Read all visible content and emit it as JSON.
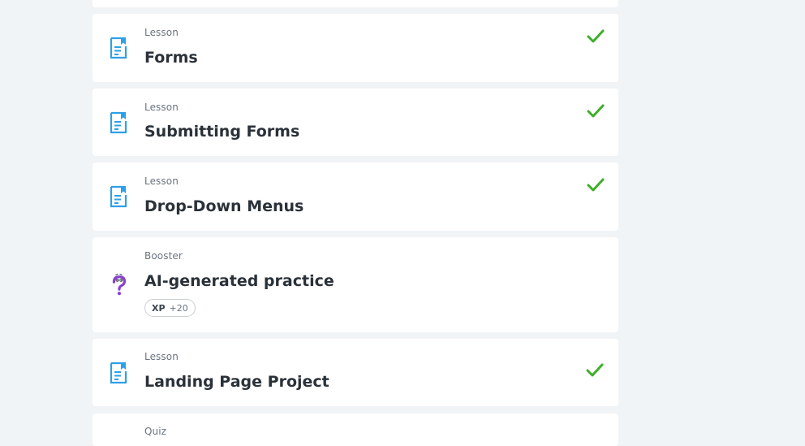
{
  "items": [
    {
      "type": "Lesson",
      "title": "Forms",
      "icon": "lesson-icon",
      "completed": true
    },
    {
      "type": "Lesson",
      "title": "Submitting Forms",
      "icon": "lesson-icon",
      "completed": true
    },
    {
      "type": "Lesson",
      "title": "Drop-Down Menus",
      "icon": "lesson-icon",
      "completed": true
    },
    {
      "type": "Booster",
      "title": "AI-generated practice",
      "icon": "question-mark-icon",
      "completed": false,
      "xp_label": "XP",
      "xp_value": "+20"
    },
    {
      "type": "Lesson",
      "title": "Landing Page Project",
      "icon": "lesson-icon",
      "completed": true
    },
    {
      "type": "Quiz",
      "title": "",
      "icon": "",
      "completed": false
    }
  ],
  "colors": {
    "background": "#f1f4f7",
    "card": "#ffffff",
    "lesson_icon": "#2ea0e6",
    "check": "#3fae2a",
    "booster_icon": "#8b3fd1"
  }
}
